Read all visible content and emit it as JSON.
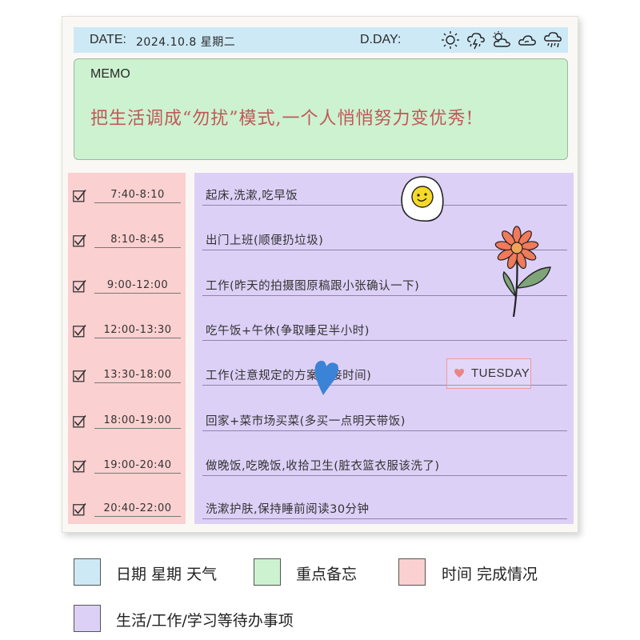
{
  "header": {
    "date_label": "DATE:",
    "date_value": "2024.10.8 星期二",
    "dday_label": "D.DAY:",
    "weather_icons": [
      "sun-icon",
      "thunderstorm-icon",
      "partly-cloudy-icon",
      "cloud-icon",
      "rain-cloud-icon"
    ]
  },
  "memo": {
    "label": "MEMO",
    "text": "把生活调成“勿扰”模式,一个人悄悄努力变优秀!"
  },
  "schedule": [
    {
      "time": "7:40-8:10",
      "task": "起床,洗漱,吃早饭",
      "done": true
    },
    {
      "time": "8:10-8:45",
      "task": "出门上班(顺便扔垃圾)",
      "done": true
    },
    {
      "time": "9:00-12:00",
      "task": "工作(昨天的拍摄图原稿跟小张确认一下)",
      "done": true
    },
    {
      "time": "12:00-13:30",
      "task": "吃午饭+午休(争取睡足半小时)",
      "done": true
    },
    {
      "time": "13:30-18:00",
      "task": "工作(注意规定的方案交接时间)",
      "done": true
    },
    {
      "time": "18:00-19:00",
      "task": "回家+菜市场买菜(多买一点明天带饭)",
      "done": true
    },
    {
      "time": "19:00-20:40",
      "task": "做晚饭,吃晚饭,收拾卫生(脏衣篮衣服该洗了)",
      "done": true
    },
    {
      "time": "20:40-22:00",
      "task": "洗漱护肤,保持睡前阅读30分钟",
      "done": true
    }
  ],
  "sticker": {
    "tuesday_label": "TUESDAY"
  },
  "legend": [
    {
      "color": "#cde9f6",
      "label": "日期 星期 天气"
    },
    {
      "color": "#ccf2cf",
      "label": "重点备忘"
    },
    {
      "color": "#fbd0d0",
      "label": "时间 完成情况"
    },
    {
      "color": "#ddd0f7",
      "label": "生活/工作/学习等待办事项"
    }
  ],
  "colors": {
    "memo_text": "#c0585a",
    "date_bar": "#cde9f6",
    "memo_bg": "#ccf2cf",
    "time_bg": "#fbd0d0",
    "task_bg": "#ddd0f7"
  }
}
